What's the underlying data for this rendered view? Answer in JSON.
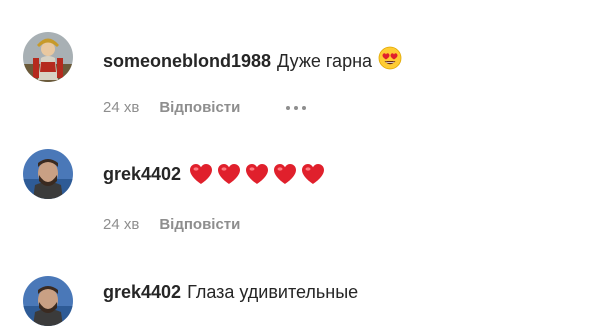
{
  "top_partial": "",
  "comments": [
    {
      "username": "someoneblond1988",
      "text": "Дуже гарна",
      "emoji": "smiling-face-with-heart-eyes",
      "time": "24 хв",
      "reply_label": "Відповісти",
      "show_more": true
    },
    {
      "username": "grek4402",
      "text": "",
      "emoji": "red-heart x5",
      "time": "24 хв",
      "reply_label": "Відповісти",
      "show_more": false
    },
    {
      "username": "grek4402",
      "text": "Глаза удивительные",
      "emoji": "",
      "show_more": false
    }
  ],
  "colors": {
    "primary_text": "#262626",
    "secondary_text": "#8e8e8e",
    "heart": "#e0202c"
  }
}
